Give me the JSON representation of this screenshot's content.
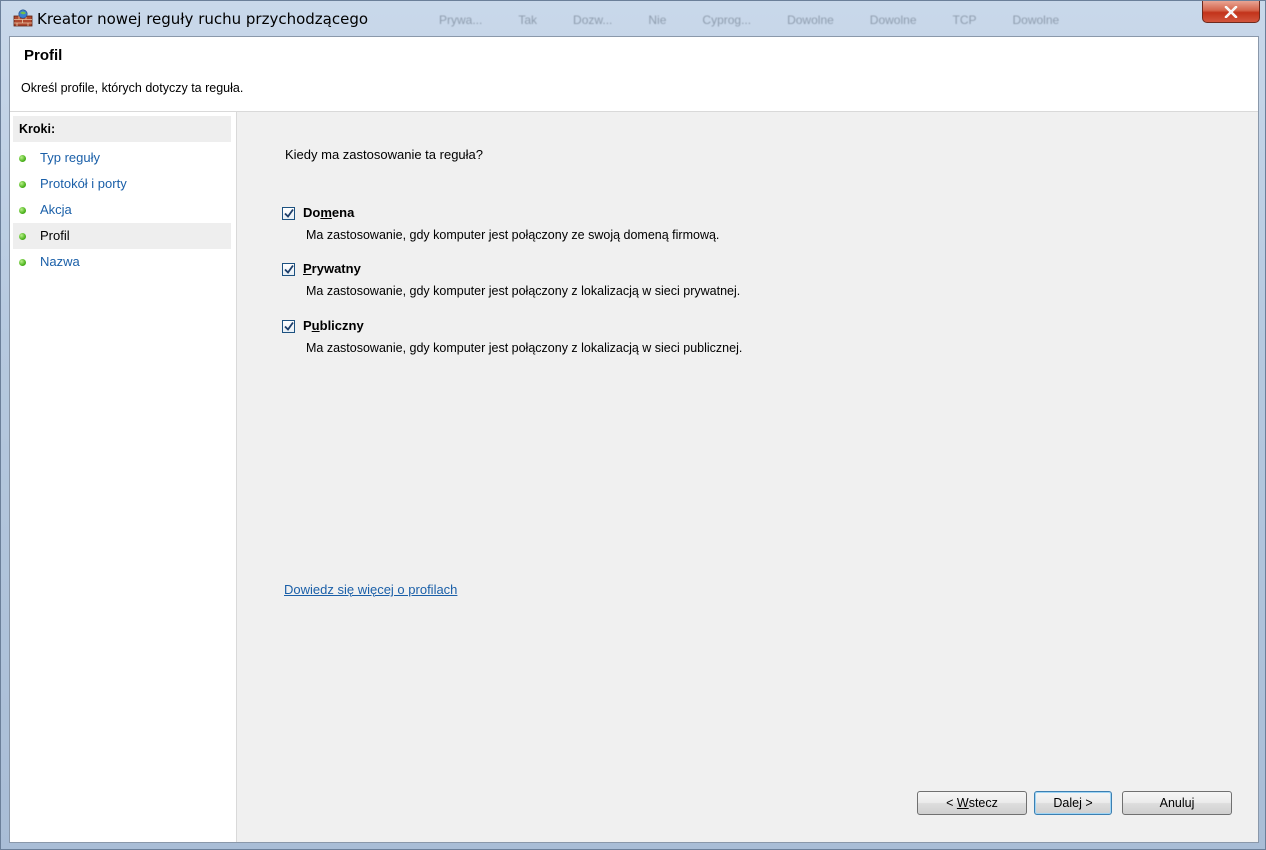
{
  "window": {
    "title": "Kreator nowej reguły ruchu przychodzącego",
    "background_columns": [
      "Prywa...",
      "Tak",
      "Dozw...",
      "Nie",
      "Cyprog...",
      "Dowolne",
      "Dowolne",
      "TCP",
      "Dowolne"
    ]
  },
  "header": {
    "title": "Profil",
    "description": "Określ profile, których dotyczy ta reguła."
  },
  "steps": {
    "heading": "Kroki:",
    "items": [
      {
        "label": "Typ reguły",
        "state": "done"
      },
      {
        "label": "Protokół i porty",
        "state": "done"
      },
      {
        "label": "Akcja",
        "state": "done"
      },
      {
        "label": "Profil",
        "state": "current"
      },
      {
        "label": "Nazwa",
        "state": "pending"
      }
    ]
  },
  "content": {
    "question": "Kiedy ma zastosowanie ta reguła?",
    "options": [
      {
        "label_pre": "Do",
        "label_accel": "m",
        "label_post": "ena",
        "checked": true,
        "description": "Ma zastosowanie, gdy komputer jest połączony ze swoją domeną firmową."
      },
      {
        "label_pre": "",
        "label_accel": "P",
        "label_post": "rywatny",
        "checked": true,
        "description": "Ma zastosowanie, gdy komputer jest połączony z lokalizacją w sieci prywatnej."
      },
      {
        "label_pre": "P",
        "label_accel": "u",
        "label_post": "bliczny",
        "checked": true,
        "description": "Ma zastosowanie, gdy komputer jest połączony z lokalizacją w sieci publicznej."
      }
    ],
    "learn_more": "Dowiedz się więcej o profilach"
  },
  "buttons": {
    "back_pre": "< ",
    "back_accel": "W",
    "back_post": "stecz",
    "next_label": "Dalej >",
    "cancel_label": "Anuluj"
  },
  "colors": {
    "link": "#1a5fa8",
    "step_done_dot": "#4fb51f",
    "close_button": "#c2331a"
  },
  "icons": {
    "app": "firewall-wall-icon",
    "close": "close-x-icon",
    "check": "checkmark-icon",
    "step": "green-dot-icon"
  }
}
